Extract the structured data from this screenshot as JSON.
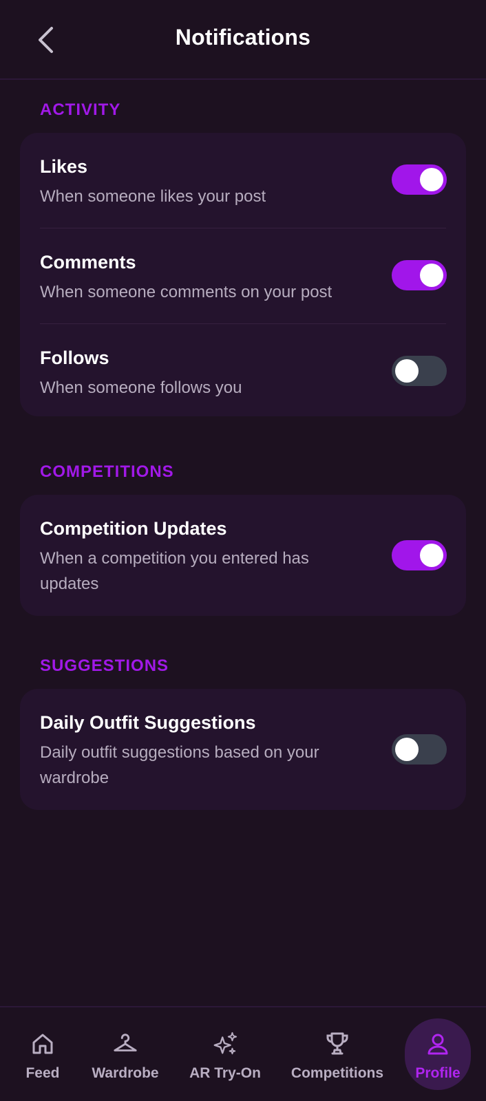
{
  "header": {
    "title": "Notifications"
  },
  "sections": {
    "activity": {
      "label": "ACTIVITY",
      "rows": [
        {
          "title": "Likes",
          "description": "When someone likes your post",
          "enabled": true
        },
        {
          "title": "Comments",
          "description": "When someone comments on your post",
          "enabled": true
        },
        {
          "title": "Follows",
          "description": "When someone follows you",
          "enabled": false
        }
      ]
    },
    "competitions": {
      "label": "COMPETITIONS",
      "rows": [
        {
          "title": "Competition Updates",
          "description": "When a competition you entered has updates",
          "enabled": true
        }
      ]
    },
    "suggestions": {
      "label": "SUGGESTIONS",
      "rows": [
        {
          "title": "Daily Outfit Suggestions",
          "description": "Daily outfit suggestions based on your wardrobe",
          "enabled": false
        }
      ]
    }
  },
  "bottom_nav": {
    "items": [
      {
        "label": "Feed",
        "icon": "home-icon"
      },
      {
        "label": "Wardrobe",
        "icon": "hanger-icon"
      },
      {
        "label": "AR Try-On",
        "icon": "sparkles-icon"
      },
      {
        "label": "Competitions",
        "icon": "trophy-icon"
      },
      {
        "label": "Profile",
        "icon": "person-icon",
        "active": true
      }
    ]
  },
  "colors": {
    "background": "#1d1120",
    "card": "#24132d",
    "accent": "#a116ea",
    "toggle_off": "#3a404d",
    "muted_text": "#b7adbf"
  }
}
